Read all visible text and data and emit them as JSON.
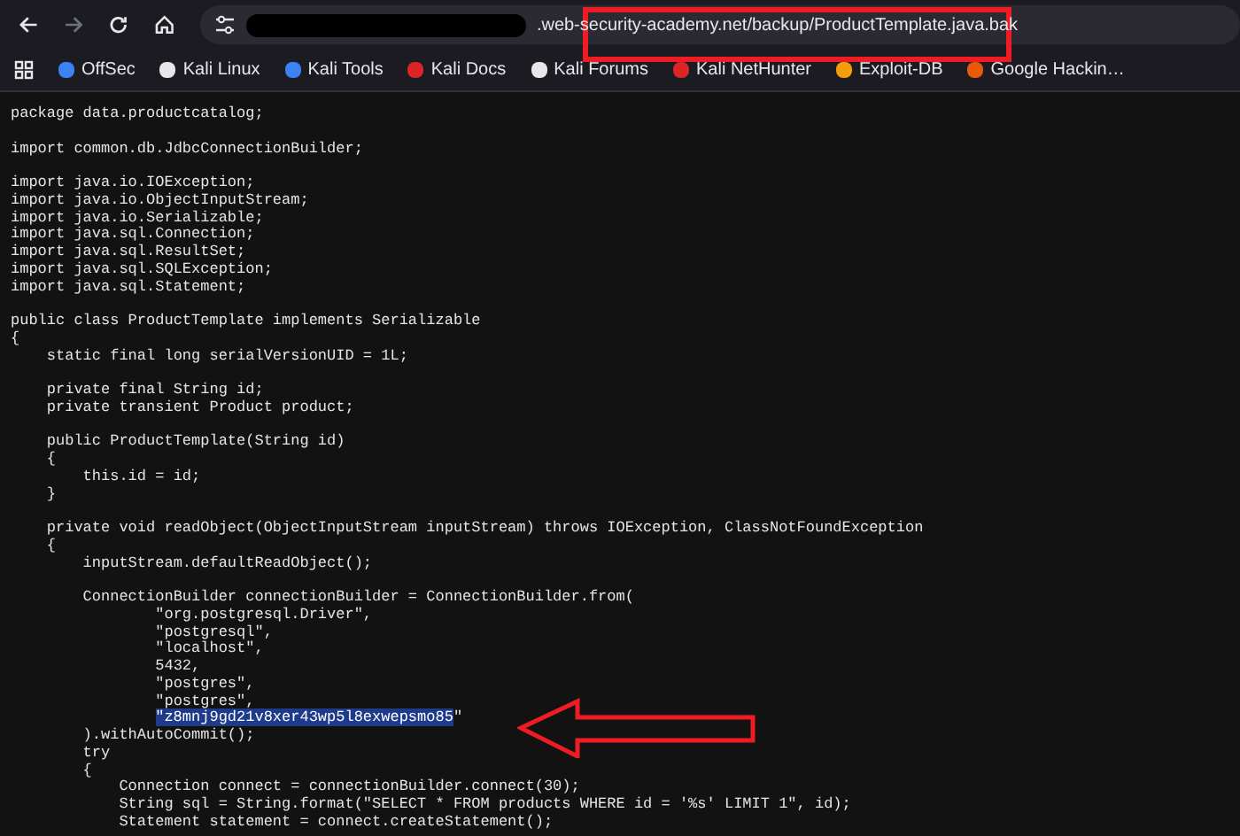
{
  "toolbar": {
    "url": ".web-security-academy.net/backup/ProductTemplate.java.bak"
  },
  "bookmarks": [
    {
      "label": "OffSec",
      "color": "#3b82f6"
    },
    {
      "label": "Kali Linux",
      "color": "#e5e7eb"
    },
    {
      "label": "Kali Tools",
      "color": "#3b82f6"
    },
    {
      "label": "Kali Docs",
      "color": "#dc2626"
    },
    {
      "label": "Kali Forums",
      "color": "#e5e7eb"
    },
    {
      "label": "Kali NetHunter",
      "color": "#dc2626"
    },
    {
      "label": "Exploit-DB",
      "color": "#f59e0b"
    },
    {
      "label": "Google Hackin…",
      "color": "#ea580c"
    }
  ],
  "code_lines": [
    {
      "kind": "text",
      "text": "package data.productcatalog;"
    },
    {
      "kind": "blank"
    },
    {
      "kind": "text",
      "text": "import common.db.JdbcConnectionBuilder;"
    },
    {
      "kind": "blank"
    },
    {
      "kind": "text",
      "text": "import java.io.IOException;"
    },
    {
      "kind": "text",
      "text": "import java.io.ObjectInputStream;"
    },
    {
      "kind": "text",
      "text": "import java.io.Serializable;"
    },
    {
      "kind": "text",
      "text": "import java.sql.Connection;"
    },
    {
      "kind": "text",
      "text": "import java.sql.ResultSet;"
    },
    {
      "kind": "text",
      "text": "import java.sql.SQLException;"
    },
    {
      "kind": "text",
      "text": "import java.sql.Statement;"
    },
    {
      "kind": "blank"
    },
    {
      "kind": "text",
      "text": "public class ProductTemplate implements Serializable"
    },
    {
      "kind": "text",
      "text": "{"
    },
    {
      "kind": "text",
      "text": "    static final long serialVersionUID = 1L;"
    },
    {
      "kind": "blank"
    },
    {
      "kind": "text",
      "text": "    private final String id;"
    },
    {
      "kind": "text",
      "text": "    private transient Product product;"
    },
    {
      "kind": "blank"
    },
    {
      "kind": "text",
      "text": "    public ProductTemplate(String id)"
    },
    {
      "kind": "text",
      "text": "    {"
    },
    {
      "kind": "text",
      "text": "        this.id = id;"
    },
    {
      "kind": "text",
      "text": "    }"
    },
    {
      "kind": "blank"
    },
    {
      "kind": "text",
      "text": "    private void readObject(ObjectInputStream inputStream) throws IOException, ClassNotFoundException"
    },
    {
      "kind": "text",
      "text": "    {"
    },
    {
      "kind": "text",
      "text": "        inputStream.defaultReadObject();"
    },
    {
      "kind": "blank"
    },
    {
      "kind": "text",
      "text": "        ConnectionBuilder connectionBuilder = ConnectionBuilder.from("
    },
    {
      "kind": "text",
      "text": "                \"org.postgresql.Driver\","
    },
    {
      "kind": "text",
      "text": "                \"postgresql\","
    },
    {
      "kind": "text",
      "text": "                \"localhost\","
    },
    {
      "kind": "text",
      "text": "                5432,"
    },
    {
      "kind": "text",
      "text": "                \"postgres\","
    },
    {
      "kind": "text",
      "text": "                \"postgres\","
    },
    {
      "kind": "selection",
      "selected": "\"z8mnj9gd21v8xer43wp5l8exwepsmo85",
      "after": "\""
    },
    {
      "kind": "text",
      "text": "        ).withAutoCommit();"
    },
    {
      "kind": "text",
      "text": "        try"
    },
    {
      "kind": "text",
      "text": "        {"
    },
    {
      "kind": "text",
      "text": "            Connection connect = connectionBuilder.connect(30);"
    },
    {
      "kind": "text",
      "text": "            String sql = String.format(\"SELECT * FROM products WHERE id = '%s' LIMIT 1\", id);"
    },
    {
      "kind": "text",
      "text": "            Statement statement = connect.createStatement();"
    }
  ]
}
